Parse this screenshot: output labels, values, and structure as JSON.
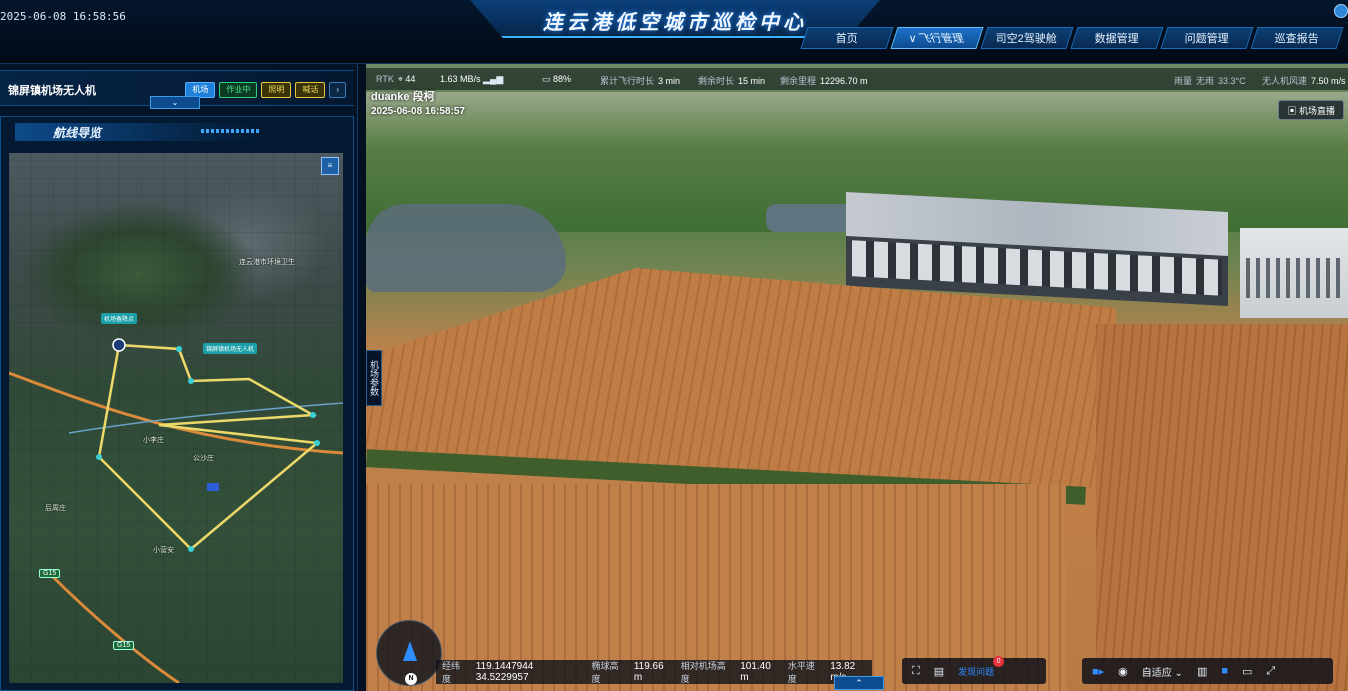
{
  "header": {
    "datetime": "2025-06-08  16:58:56",
    "title": "连云港低空城市巡检中心",
    "nav": [
      {
        "label": "首页",
        "active": false
      },
      {
        "label": "飞行管理",
        "active": true
      },
      {
        "label": "司空2驾驶舱",
        "active": false
      },
      {
        "label": "数据管理",
        "active": false
      },
      {
        "label": "问题管理",
        "active": false
      },
      {
        "label": "巡查报告",
        "active": false
      }
    ]
  },
  "left": {
    "drone_name": "锦屏镇机场无人机",
    "chips": [
      "机场",
      "作业中",
      "照明",
      "喊话"
    ],
    "route_title": "航线导览",
    "map": {
      "labels": [
        "连云港市环境卫生",
        "后周庄",
        "小营安",
        "机场备降点",
        "锦屏镇机场无人机",
        "小李庄",
        "公沙庄"
      ],
      "road_signs": [
        "G15",
        "G15"
      ]
    }
  },
  "video": {
    "osd": {
      "rtk_label": "RTK",
      "rtk_value": "44",
      "speed_net": "1.63 MB/s",
      "battery": "88%",
      "total_flight_label": "累计飞行时长",
      "total_flight": "3 min",
      "remain_time_label": "剩余时长",
      "remain_time": "15 min",
      "remain_dist_label": "剩余里程",
      "remain_dist": "12296.70 m",
      "rain_label": "雨量",
      "rain": "无雨",
      "temp": "33.3°C",
      "wind_label": "无人机风速",
      "wind": "7.50 m/s"
    },
    "pilot": "duanke 段柯",
    "timestamp": "2025-06-08 16:58:57",
    "live_label": "机场直播",
    "side_tab": "机场参数",
    "telemetry": {
      "coord_label": "经纬度",
      "coord": "119.1447944 34.5229957",
      "ell_label": "椭球高度",
      "ell": "119.66 m",
      "rel_label": "相对机场高度",
      "rel": "101.40 m",
      "hspeed_label": "水平速度",
      "hspeed": "13.82 m/s"
    },
    "toolbar": {
      "problem_label": "发现问题",
      "problem_count": "0",
      "fit_label": "自适应"
    }
  }
}
